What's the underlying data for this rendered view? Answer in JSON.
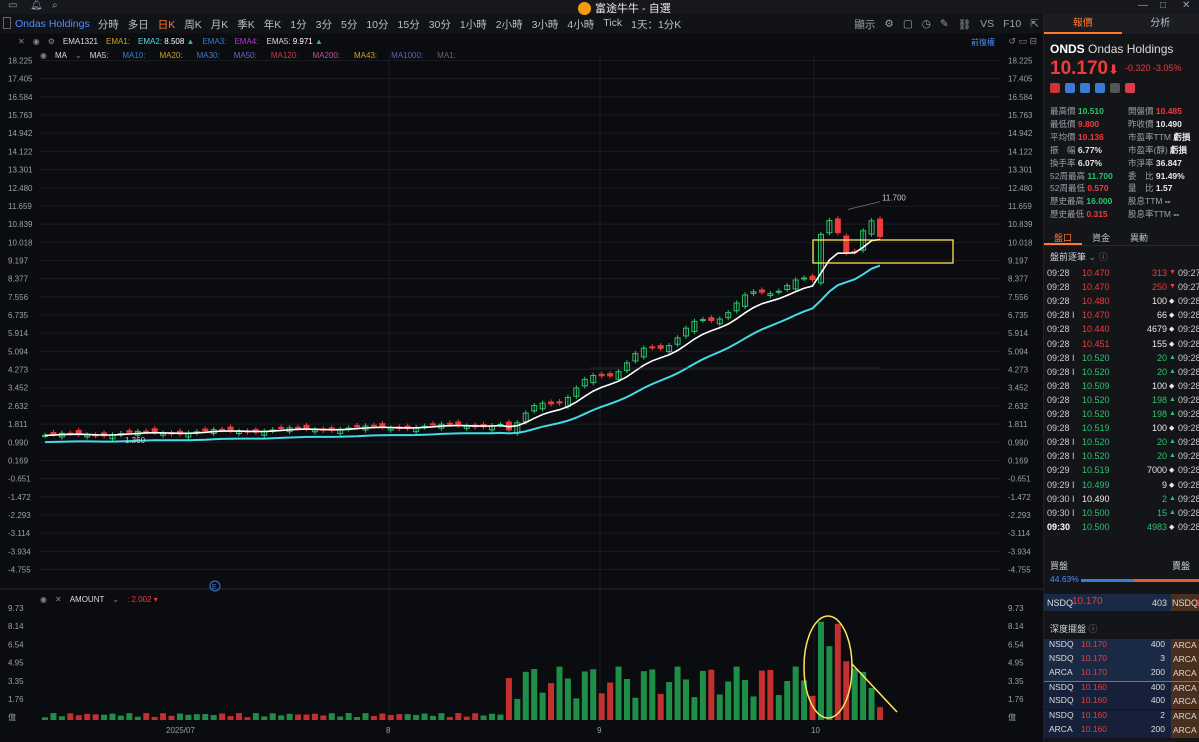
{
  "titlebar": {
    "app_title": "富途牛牛 - 自選"
  },
  "toolbar": {
    "symbol_name": "Ondas Holdings",
    "timeframes": [
      "分時",
      "多日",
      "日K",
      "周K",
      "月K",
      "季K",
      "年K",
      "1分",
      "3分",
      "5分",
      "10分",
      "15分",
      "30分",
      "1小時",
      "2小時",
      "3小時",
      "4小時",
      "Tick",
      "1天：1分K"
    ],
    "active_timeframe": "日K",
    "right_display": "顯示"
  },
  "chart": {
    "ema_row": {
      "name": "EMA1321",
      "ema1": "EMA1:",
      "ema2_label": "EMA2:",
      "ema2": "8.508",
      "ema3": "EMA3:",
      "ema4": "EMA4:",
      "ema5_label": "EMA5:",
      "ema5": "9.971"
    },
    "ma_row": {
      "name": "MA",
      "items": [
        "MA5:",
        "MA10:",
        "MA20:",
        "MA30:",
        "MA50:",
        "MA120:",
        "MA200:",
        "MA43:",
        "MA1000:",
        "MA1:"
      ]
    },
    "adjust_label": "前復權",
    "y_ticks": [
      "18.225",
      "17.405",
      "16.584",
      "15.763",
      "14.942",
      "14.122",
      "13.301",
      "12.480",
      "11.659",
      "10.839",
      "10.018",
      "9.197",
      "8.377",
      "7.556",
      "6.735",
      "5.914",
      "5.094",
      "4.273",
      "3.452",
      "2.632",
      "1.811",
      "0.990",
      "0.169",
      "-0.651",
      "-1.472",
      "-2.293",
      "-3.114",
      "-3.934",
      "-4.755"
    ],
    "high_label": "11.700",
    "low_label": "1.360",
    "amount": {
      "name": "AMOUNT",
      "value": "2.002",
      "ticks": [
        "9.73",
        "8.14",
        "6.54",
        "4.95",
        "3.35",
        "1.76",
        "億"
      ]
    },
    "x_labels": [
      "2025/07",
      "8",
      "9",
      "10"
    ],
    "event_marker": "E"
  },
  "chart_data": {
    "type": "candlestick",
    "title": "",
    "ylim": [
      -4.755,
      18.225
    ],
    "series": [
      {
        "name": "EMA2",
        "value_last": 8.508
      },
      {
        "name": "EMA5",
        "value_last": 9.971
      }
    ],
    "price_high": 11.7,
    "price_low": 1.36,
    "volume_ylim": [
      0,
      9.73
    ]
  },
  "panel": {
    "tabs": [
      "報價",
      "分析"
    ],
    "ticker": "ONDS",
    "company": "Ondas Holdings",
    "price": "10.170",
    "change": "-0.320",
    "change_pct": "-3.05%",
    "stats_left": [
      {
        "k": "最高價",
        "v": "10.510",
        "c": "green"
      },
      {
        "k": "最低價",
        "v": "9.800",
        "c": "red"
      },
      {
        "k": "平均價",
        "v": "10.136",
        "c": "red"
      },
      {
        "k": "振　幅",
        "v": "6.77%",
        "c": "white"
      },
      {
        "k": "換手率",
        "v": "6.07%",
        "c": "white"
      },
      {
        "k": "52周最高",
        "v": "11.700",
        "c": "green"
      },
      {
        "k": "52周最低",
        "v": "0.570",
        "c": "red"
      },
      {
        "k": "歷史最高",
        "v": "16.000",
        "c": "green"
      },
      {
        "k": "歷史最低",
        "v": "0.315",
        "c": "red"
      }
    ],
    "stats_right": [
      {
        "k": "開盤價",
        "v": "10.485",
        "c": "red"
      },
      {
        "k": "昨收價",
        "v": "10.490",
        "c": "white"
      },
      {
        "k": "市盈率TTM",
        "v": "虧損",
        "c": "white"
      },
      {
        "k": "市盈率(靜)",
        "v": "虧損",
        "c": "white"
      },
      {
        "k": "市淨率",
        "v": "36.847",
        "c": "white"
      },
      {
        "k": "委　比",
        "v": "91.49%",
        "c": "white"
      },
      {
        "k": "量　比",
        "v": "1.57",
        "c": "white"
      },
      {
        "k": "股息TTM",
        "v": "--",
        "c": "white"
      },
      {
        "k": "股息率TTM",
        "v": "--",
        "c": "white"
      }
    ],
    "subtabs": [
      "盤口",
      "資金",
      "異動"
    ],
    "premarket_title": "盤前逐筆",
    "trades": [
      {
        "t": "09:28",
        "p": "10.470",
        "pc": "red",
        "v": "313",
        "vc": "red",
        "d": "▼",
        "t2": "09:27"
      },
      {
        "t": "09:28",
        "p": "10.470",
        "pc": "red",
        "v": "250",
        "vc": "red",
        "d": "▼",
        "t2": "09:27 I"
      },
      {
        "t": "09:28",
        "p": "10.480",
        "pc": "red",
        "v": "100",
        "vc": "white",
        "d": "◆",
        "t2": "09:28 I"
      },
      {
        "t": "09:28 I",
        "p": "10.470",
        "pc": "red",
        "v": "66",
        "vc": "white",
        "d": "◆",
        "t2": "09:28 I"
      },
      {
        "t": "09:28",
        "p": "10.440",
        "pc": "red",
        "v": "4679",
        "vc": "white",
        "d": "◆",
        "t2": "09:28 I"
      },
      {
        "t": "09:28",
        "p": "10.451",
        "pc": "red",
        "v": "155",
        "vc": "white",
        "d": "◆",
        "t2": "09:28 I"
      },
      {
        "t": "09:28 I",
        "p": "10.520",
        "pc": "green",
        "v": "20",
        "vc": "green",
        "d": "▲",
        "t2": "09:28 I"
      },
      {
        "t": "09:28 I",
        "p": "10.520",
        "pc": "green",
        "v": "20",
        "vc": "green",
        "d": "▲",
        "t2": "09:28 I"
      },
      {
        "t": "09:28",
        "p": "10.509",
        "pc": "green",
        "v": "100",
        "vc": "white",
        "d": "◆",
        "t2": "09:28 I"
      },
      {
        "t": "09:28",
        "p": "10.520",
        "pc": "green",
        "v": "198",
        "vc": "green",
        "d": "▲",
        "t2": "09:28 I"
      },
      {
        "t": "09:28",
        "p": "10.520",
        "pc": "green",
        "v": "198",
        "vc": "green",
        "d": "▲",
        "t2": "09:28 I"
      },
      {
        "t": "09:28",
        "p": "10.519",
        "pc": "green",
        "v": "100",
        "vc": "white",
        "d": "◆",
        "t2": "09:28 I"
      },
      {
        "t": "09:28 I",
        "p": "10.520",
        "pc": "green",
        "v": "20",
        "vc": "green",
        "d": "▲",
        "t2": "09:28 I"
      },
      {
        "t": "09:28 I",
        "p": "10.520",
        "pc": "green",
        "v": "20",
        "vc": "green",
        "d": "▲",
        "t2": "09:28 I"
      },
      {
        "t": "09:29",
        "p": "10.519",
        "pc": "green",
        "v": "7000",
        "vc": "white",
        "d": "◆",
        "t2": "09:28 I"
      },
      {
        "t": "09:29 I",
        "p": "10.499",
        "pc": "green",
        "v": "9",
        "vc": "white",
        "d": "◆",
        "t2": "09:28 I"
      },
      {
        "t": "09:30 I",
        "p": "10.490",
        "pc": "white",
        "v": "2",
        "vc": "green",
        "d": "▲",
        "t2": "09:28 I"
      },
      {
        "t": "09:30 I",
        "p": "10.500",
        "pc": "green",
        "v": "15",
        "vc": "green",
        "d": "▲",
        "t2": "09:28 I"
      },
      {
        "t": "09:30",
        "p": "10.500",
        "pc": "green",
        "v": "4983",
        "vc": "green",
        "d": "◆",
        "t2": "09:28"
      }
    ],
    "buysell": {
      "buy": "買盤",
      "sell": "賣盤",
      "pct": "44.63%",
      "buy_fraction": 0.4463
    },
    "nbbo": {
      "ex": "NSDQ",
      "bid": "10.170",
      "size": "403",
      "ex2": "NSDQ",
      "ask": "1"
    },
    "depth_title": "深度擺盤",
    "depth": [
      {
        "ex": "NSDQ",
        "p": "10.170",
        "s": "400",
        "r": "ARCA"
      },
      {
        "ex": "NSDQ",
        "p": "10.170",
        "s": "3",
        "r": "ARCA"
      },
      {
        "ex": "ARCA",
        "p": "10.170",
        "s": "200",
        "r": "ARCA"
      },
      {
        "ex": "NSDQ",
        "p": "10.160",
        "s": "400",
        "r": "ARCA"
      },
      {
        "ex": "NSDQ",
        "p": "10.160",
        "s": "400",
        "r": "ARCA"
      },
      {
        "ex": "NSDQ",
        "p": "10.160",
        "s": "2",
        "r": "ARCA"
      },
      {
        "ex": "ARCA",
        "p": "10.160",
        "s": "200",
        "r": "ARCA"
      }
    ]
  }
}
